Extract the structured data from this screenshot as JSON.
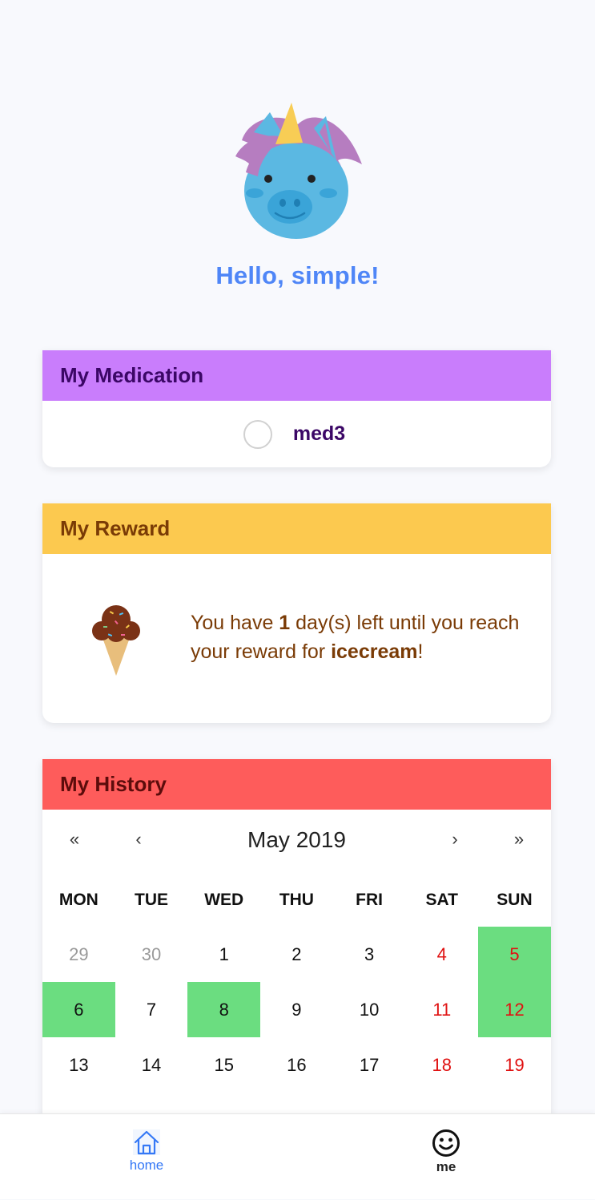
{
  "header": {
    "avatar_icon": "unicorn-icon",
    "greeting": "Hello, simple!"
  },
  "medication": {
    "title": "My Medication",
    "items": [
      {
        "name": "med3",
        "checked": false
      }
    ]
  },
  "reward": {
    "title": "My Reward",
    "icon": "icecream-icon",
    "text_prefix": "You have ",
    "days_left": "1",
    "text_middle": " day(s) left until you reach your reward for ",
    "reward_name": "icecream",
    "text_suffix": "!"
  },
  "history": {
    "title": "My History",
    "nav": {
      "prev_year": "«",
      "prev_month": "‹",
      "month_label": "May 2019",
      "next_month": "›",
      "next_year": "»"
    },
    "weekdays": [
      "MON",
      "TUE",
      "WED",
      "THU",
      "FRI",
      "SAT",
      "SUN"
    ],
    "days": [
      {
        "label": "29",
        "muted": true,
        "weekend": false,
        "taken": false
      },
      {
        "label": "30",
        "muted": true,
        "weekend": false,
        "taken": false
      },
      {
        "label": "1",
        "muted": false,
        "weekend": false,
        "taken": false
      },
      {
        "label": "2",
        "muted": false,
        "weekend": false,
        "taken": false
      },
      {
        "label": "3",
        "muted": false,
        "weekend": false,
        "taken": false
      },
      {
        "label": "4",
        "muted": false,
        "weekend": true,
        "taken": false
      },
      {
        "label": "5",
        "muted": false,
        "weekend": true,
        "taken": true
      },
      {
        "label": "6",
        "muted": false,
        "weekend": false,
        "taken": true
      },
      {
        "label": "7",
        "muted": false,
        "weekend": false,
        "taken": false
      },
      {
        "label": "8",
        "muted": false,
        "weekend": false,
        "taken": true
      },
      {
        "label": "9",
        "muted": false,
        "weekend": false,
        "taken": false
      },
      {
        "label": "10",
        "muted": false,
        "weekend": false,
        "taken": false
      },
      {
        "label": "11",
        "muted": false,
        "weekend": true,
        "taken": false
      },
      {
        "label": "12",
        "muted": false,
        "weekend": true,
        "taken": true
      },
      {
        "label": "13",
        "muted": false,
        "weekend": false,
        "taken": false
      },
      {
        "label": "14",
        "muted": false,
        "weekend": false,
        "taken": false
      },
      {
        "label": "15",
        "muted": false,
        "weekend": false,
        "taken": false
      },
      {
        "label": "16",
        "muted": false,
        "weekend": false,
        "taken": false
      },
      {
        "label": "17",
        "muted": false,
        "weekend": false,
        "taken": false
      },
      {
        "label": "18",
        "muted": false,
        "weekend": true,
        "taken": false
      },
      {
        "label": "19",
        "muted": false,
        "weekend": true,
        "taken": false
      }
    ]
  },
  "bottom_nav": {
    "items": [
      {
        "label": "home",
        "icon": "home-icon",
        "active": true
      },
      {
        "label": "me",
        "icon": "smiley-icon",
        "active": false
      }
    ]
  },
  "colors": {
    "accent": "#4f86f7",
    "medication_header": "#c97dfc",
    "reward_header": "#fcc94f",
    "history_header": "#fe5c5b",
    "taken_day": "#6bdd80",
    "weekend_text": "#e01212"
  }
}
